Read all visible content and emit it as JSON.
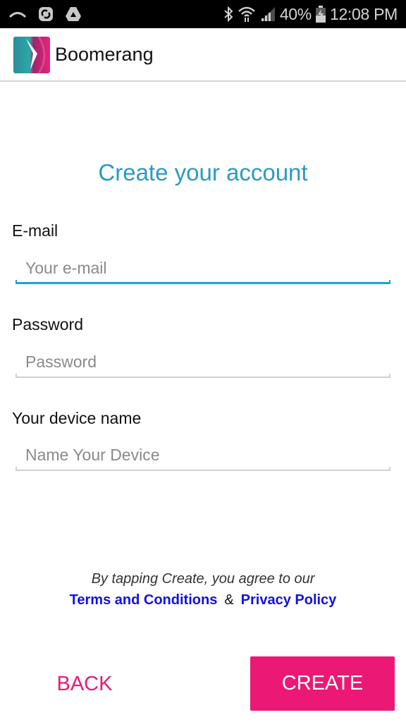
{
  "status_bar": {
    "left_icons": [
      "notification-arc-icon",
      "sync-app-icon",
      "drive-icon"
    ],
    "right_icons": [
      "bluetooth-icon",
      "wifi-icon",
      "signal-icon"
    ],
    "battery_percent": "40%",
    "battery_icon": "battery-charging-icon",
    "time": "12:08 PM"
  },
  "app_bar": {
    "title": "Boomerang",
    "logo_icon": "boomerang-logo-icon"
  },
  "form": {
    "title": "Create your account",
    "fields": [
      {
        "label": "E-mail",
        "value": "",
        "placeholder": "Your e-mail",
        "focused": true
      },
      {
        "label": "Password",
        "value": "",
        "placeholder": "Password",
        "focused": false
      },
      {
        "label": "Your device name",
        "value": "",
        "placeholder": "Name Your Device",
        "focused": false
      }
    ]
  },
  "terms": {
    "prefix": "By tapping Create, you agree to our",
    "terms_link": "Terms and Conditions",
    "separator": "&",
    "privacy_link": "Privacy Policy"
  },
  "actions": {
    "back_label": "BACK",
    "create_label": "CREATE"
  },
  "colors": {
    "accent_blue": "#2a9bc2",
    "focus_blue": "#1aa3d4",
    "brand_pink": "#ec1876",
    "link_blue": "#1010e6"
  }
}
